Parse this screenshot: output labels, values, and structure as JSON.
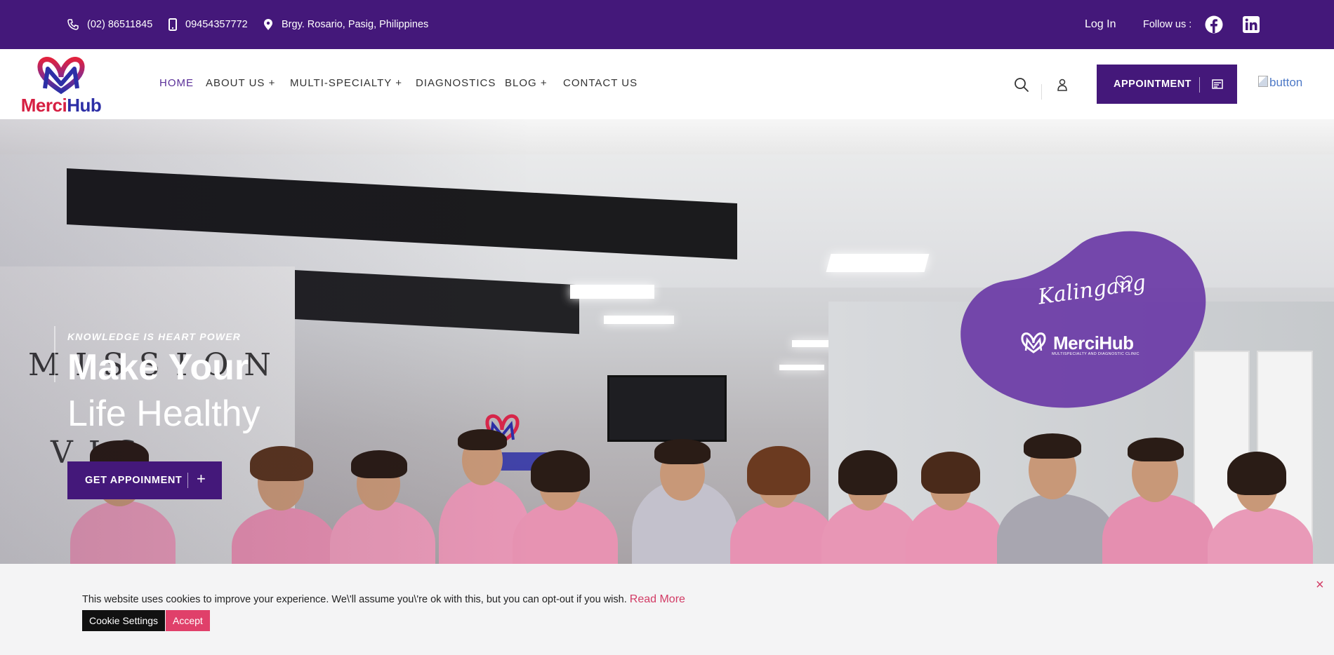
{
  "topbar": {
    "phone": "(02) 86511845",
    "mobile": "09454357772",
    "address": "Brgy. Rosario, Pasig, Philippines",
    "login": "Log In",
    "follow": "Follow us :",
    "social": [
      "facebook-icon",
      "linkedin-icon"
    ]
  },
  "header": {
    "logo_part1": "Merci",
    "logo_part2": "Hub",
    "nav": {
      "home": "HOME",
      "about": "ABOUT US +",
      "multi": "MULTI-SPECIALTY +",
      "diagnostics": "DIAGNOSTICS",
      "blog": "BLOG +",
      "contact": "CONTACT US"
    },
    "appointment": "APPOINTMENT",
    "broken_image_alt": "button"
  },
  "hero": {
    "kicker": "KNOWLEDGE IS HEART POWER",
    "title_line1": "Make Your",
    "title_line2": "Life Healthy",
    "cta": "GET APPOINMENT",
    "badge_script": "Kalingang",
    "badge_brand": "MerciHub",
    "badge_sub": "MULTISPECIALTY AND DIAGNOSTIC CLINIC"
  },
  "cookie": {
    "text": "This website uses cookies to improve your experience. We\\'ll assume you\\'re ok with this, but you can opt-out if you wish.",
    "read_more": "Read More",
    "settings": "Cookie Settings",
    "accept": "Accept",
    "close": "×"
  },
  "colors": {
    "brand_purple": "#44187a",
    "accent_pink": "#e0406a",
    "logo_red": "#d61f42",
    "logo_blue": "#2d2fa6"
  }
}
